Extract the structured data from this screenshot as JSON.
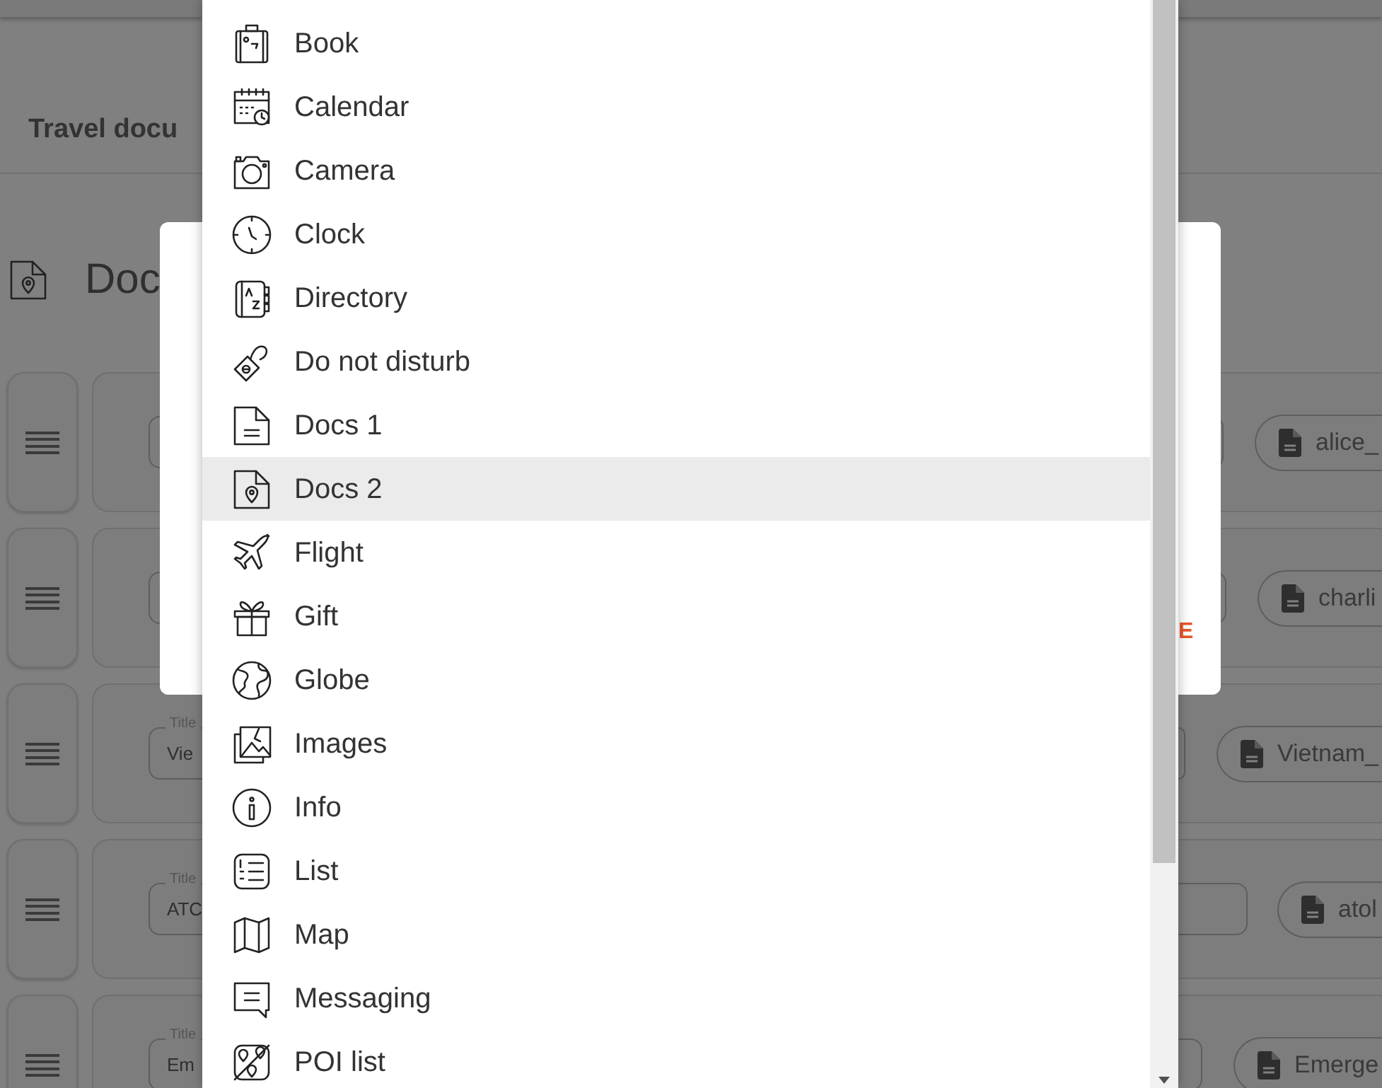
{
  "background_page": {
    "section_title": "Travel docu",
    "heading": "Doc",
    "rows": [
      {
        "file": "alice_"
      },
      {
        "file": "charli"
      },
      {
        "title_label": "Title",
        "title_value": "Vie",
        "file": "Vietnam_"
      },
      {
        "title_label": "Title",
        "title_value": "ATC",
        "file": "atol"
      },
      {
        "title_label": "Title",
        "title_value": "Em",
        "file": "Emerge"
      }
    ]
  },
  "modal": {
    "button_text": "E"
  },
  "dropdown": {
    "items": [
      {
        "label": "Book",
        "selected": false
      },
      {
        "label": "Calendar",
        "selected": false
      },
      {
        "label": "Camera",
        "selected": false
      },
      {
        "label": "Clock",
        "selected": false
      },
      {
        "label": "Directory",
        "selected": false
      },
      {
        "label": "Do not disturb",
        "selected": false
      },
      {
        "label": "Docs 1",
        "selected": false
      },
      {
        "label": "Docs 2",
        "selected": true
      },
      {
        "label": "Flight",
        "selected": false
      },
      {
        "label": "Gift",
        "selected": false
      },
      {
        "label": "Globe",
        "selected": false
      },
      {
        "label": "Images",
        "selected": false
      },
      {
        "label": "Info",
        "selected": false
      },
      {
        "label": "List",
        "selected": false
      },
      {
        "label": "Map",
        "selected": false
      },
      {
        "label": "Messaging",
        "selected": false
      },
      {
        "label": "POI list",
        "selected": false
      }
    ]
  }
}
